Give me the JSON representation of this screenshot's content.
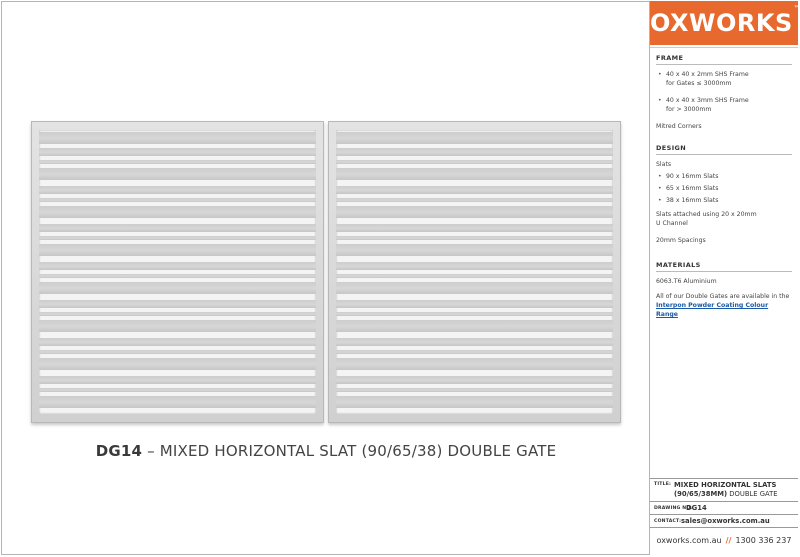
{
  "drawing": {
    "caption_code": "DG14",
    "caption_rest": " – MIXED HORIZONTAL SLAT (90/65/38) DOUBLE GATE"
  },
  "brand": {
    "name": "OXWORKS",
    "mark": "™"
  },
  "frame": {
    "heading": "FRAME",
    "bullets": [
      {
        "line1": "40 x 40 x 2mm SHS Frame",
        "line2": "for Gates ≤ 3000mm"
      },
      {
        "line1": "40 x 40 x 3mm SHS Frame",
        "line2": "for > 3000mm"
      }
    ],
    "corners": "Mitred Corners"
  },
  "design": {
    "heading": "DESIGN",
    "slats_label": "Slats",
    "slats": [
      "90 x 16mm Slats",
      "65 x 16mm Slats",
      "38 x 16mm Slats"
    ],
    "attach_line1": "Slats attached using 20 x 20mm",
    "attach_line2": "U Channel",
    "spacing": "20mm Spacings"
  },
  "materials": {
    "heading": "MATERIALS",
    "alloy": "6063.T6 Aluminium",
    "note_line1": "All of our Double Gates are available in the",
    "link": "Interpon Powder Coating Colour Range"
  },
  "title_block": {
    "title_label": "TITLE:",
    "title_line1": "MIXED HORIZONTAL SLATS",
    "title_line2_bold": "(90/65/38MM)",
    "title_line2_rest": " DOUBLE GATE",
    "drawing_label": "DRAWING NO.",
    "drawing_no": "DG14",
    "contact_label": "CONTACT:",
    "contact_email": "sales@oxworks.com.au"
  },
  "footer": {
    "website": "oxworks.com.au",
    "separator": "//",
    "phone": "1300 336 237"
  }
}
